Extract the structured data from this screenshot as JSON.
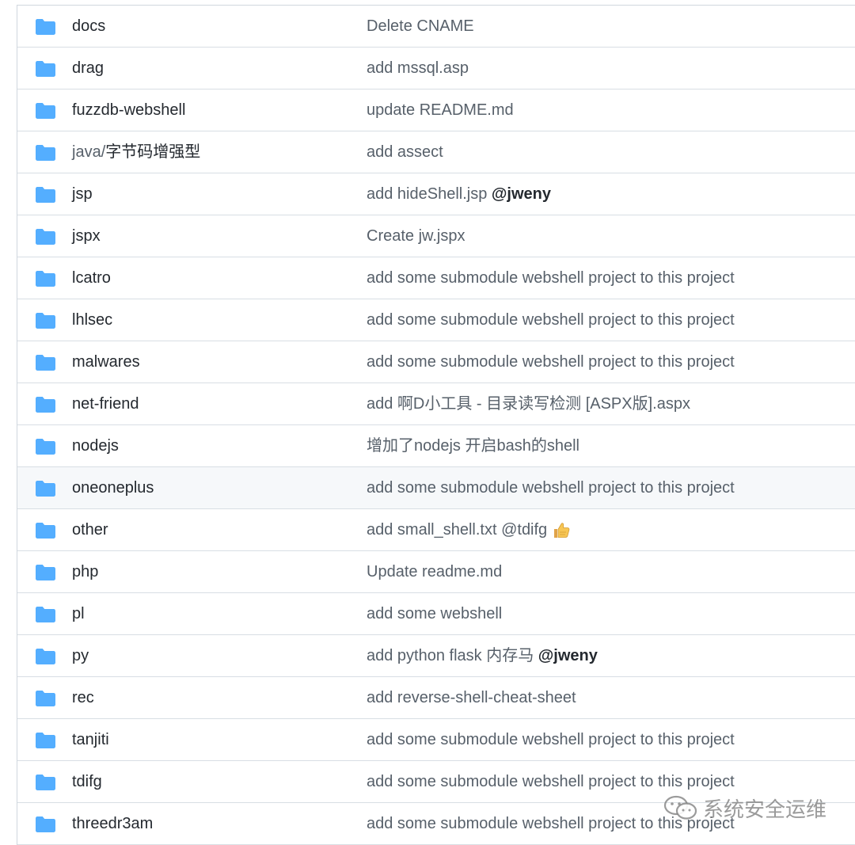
{
  "colors": {
    "folder": "#54aeff",
    "border": "#d8dee4",
    "hover_row": "#f6f8fa",
    "message_text": "#57606a",
    "name_text": "#24292f"
  },
  "rows": [
    {
      "name": "docs",
      "message": "Delete CNAME"
    },
    {
      "name": "drag",
      "message": "add mssql.asp"
    },
    {
      "name": "fuzzdb-webshell",
      "message": "update README.md"
    },
    {
      "name_prefix": "java/",
      "name": "字节码增强型",
      "message": "add assect"
    },
    {
      "name": "jsp",
      "message": "add hideShell.jsp ",
      "mention": "@jweny"
    },
    {
      "name": "jspx",
      "message": "Create jw.jspx"
    },
    {
      "name": "lcatro",
      "message": "add some submodule webshell project to this project"
    },
    {
      "name": "lhlsec",
      "message": "add some submodule webshell project to this project"
    },
    {
      "name": "malwares",
      "message": "add some submodule webshell project to this project"
    },
    {
      "name": "net-friend",
      "message": "add 啊D小工具 - 目录读写检测 [ASPX版].aspx"
    },
    {
      "name": "nodejs",
      "message": "增加了nodejs 开启bash的shell"
    },
    {
      "name": "oneoneplus",
      "message": "add some submodule webshell project to this project"
    },
    {
      "name": "other",
      "message": "add small_shell.txt @tdifg",
      "emoji": "thumbs-up-icon"
    },
    {
      "name": "php",
      "message": "Update readme.md"
    },
    {
      "name": "pl",
      "message": "add some webshell"
    },
    {
      "name": "py",
      "message": "add python flask 内存马 ",
      "mention": "@jweny"
    },
    {
      "name": "rec",
      "message": "add reverse-shell-cheat-sheet"
    },
    {
      "name": "tanjiti",
      "message": "add some submodule webshell project to this project"
    },
    {
      "name": "tdifg",
      "message": "add some submodule webshell project to this project"
    },
    {
      "name": "threedr3am",
      "message": "add some submodule webshell project to this project"
    }
  ],
  "watermark": {
    "text": "系统安全运维",
    "icon": "wechat-icon"
  }
}
